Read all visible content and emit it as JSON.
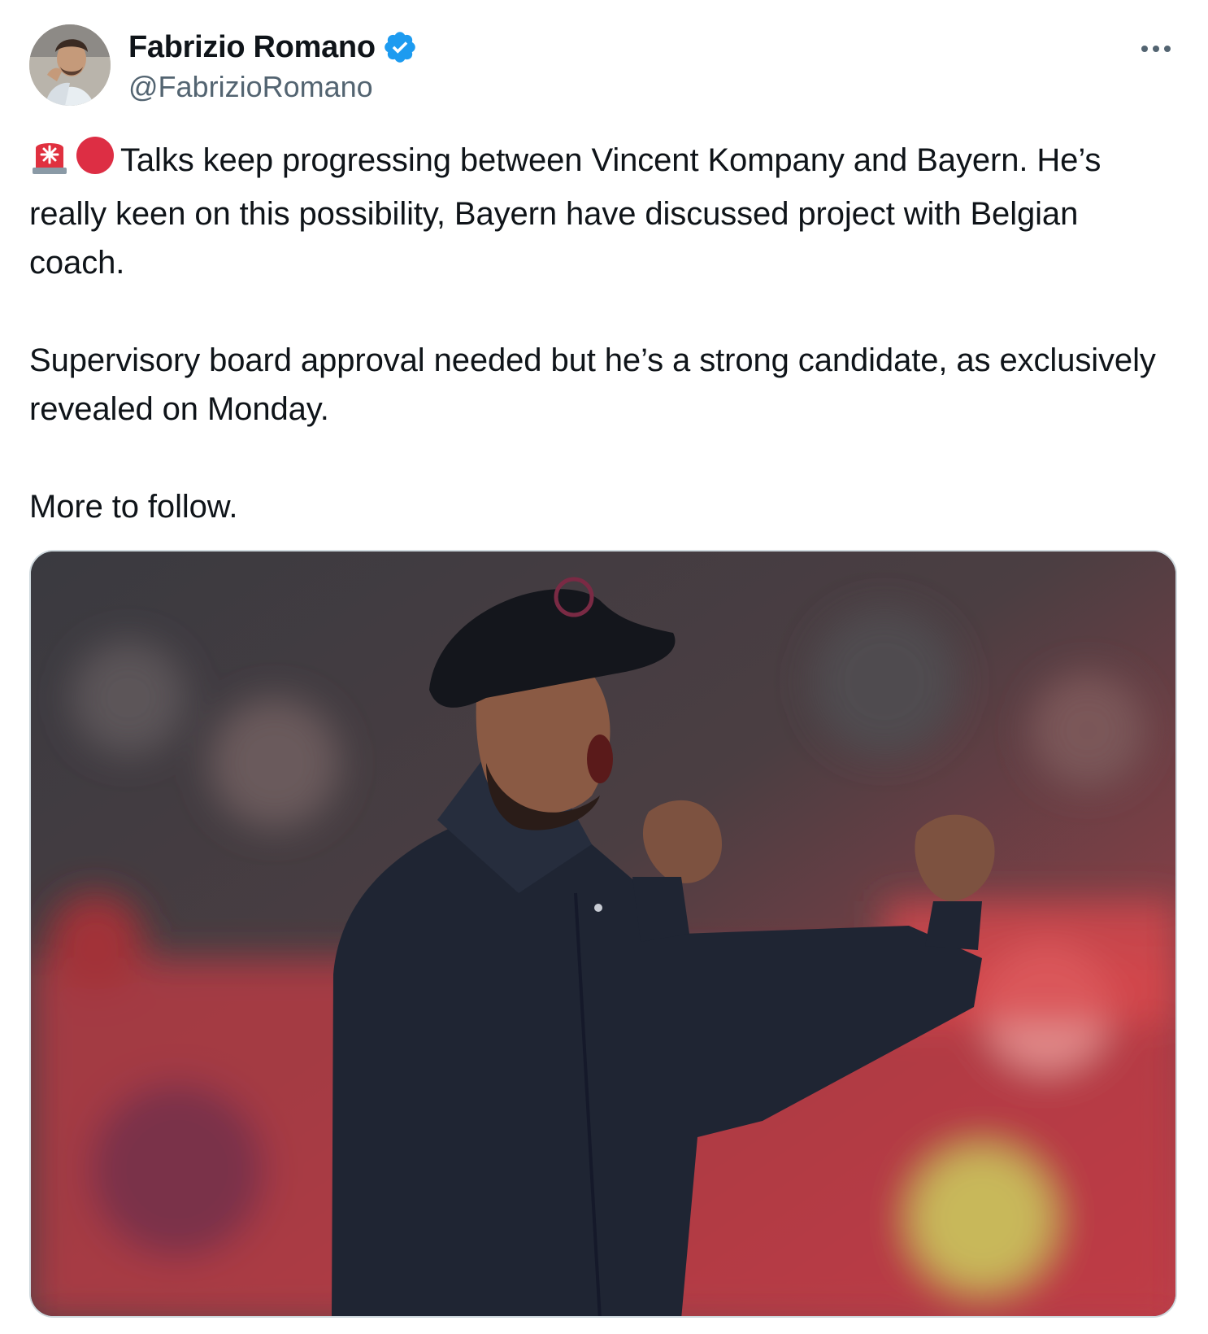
{
  "author": {
    "display_name": "Fabrizio Romano",
    "handle": "@FabrizioRomano",
    "verified": true,
    "verified_color": "#1d9bf0"
  },
  "tweet": {
    "emojis": [
      "rotating-light",
      "red-circle"
    ],
    "paragraphs": [
      "Talks keep progressing between Vincent Kompany and Bayern. He’s really keen on this possibility, Bayern have discussed project with Belgian coach.",
      "Supervisory board approval needed but he’s a strong candidate, as exclusively revealed on Monday.",
      "More to follow."
    ]
  },
  "icons": {
    "more": "more-options-icon",
    "verified": "verified-badge-icon"
  }
}
